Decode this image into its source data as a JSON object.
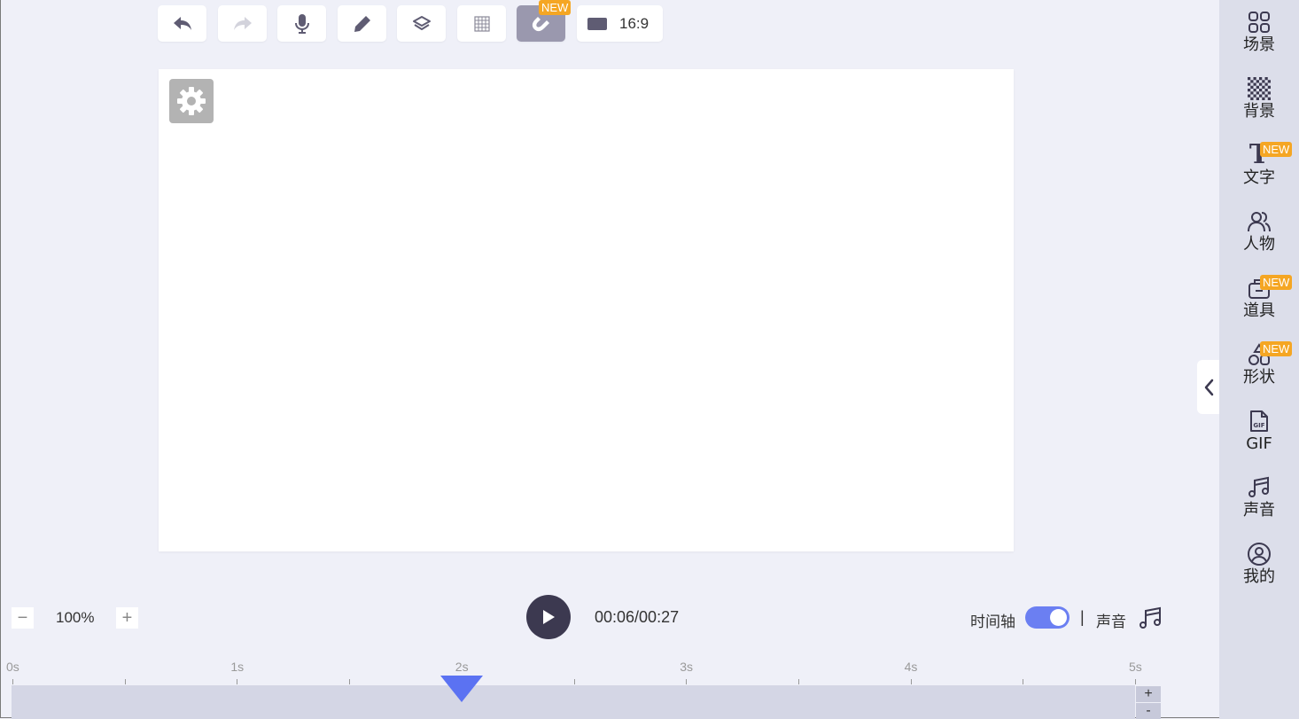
{
  "toolbar": {
    "buttons": [
      {
        "name": "undo-button",
        "icon": "undo-icon"
      },
      {
        "name": "redo-button",
        "icon": "redo-icon"
      },
      {
        "name": "microphone-button",
        "icon": "microphone-icon"
      },
      {
        "name": "pen-button",
        "icon": "pen-icon"
      },
      {
        "name": "layers-button",
        "icon": "layers-icon"
      },
      {
        "name": "grid-button",
        "icon": "grid-icon"
      },
      {
        "name": "magnet-button",
        "icon": "magnet-icon",
        "badge": "NEW",
        "active": true
      }
    ],
    "aspect_ratio": "16:9"
  },
  "canvas": {
    "settings_icon": "gear-icon"
  },
  "sidebar": {
    "items": [
      {
        "label": "场景",
        "icon": "scenes-icon"
      },
      {
        "label": "背景",
        "icon": "background-checker-icon"
      },
      {
        "label": "文字",
        "icon": "text-icon",
        "badge": "NEW"
      },
      {
        "label": "人物",
        "icon": "people-icon"
      },
      {
        "label": "道具",
        "icon": "props-icon",
        "badge": "NEW"
      },
      {
        "label": "形状",
        "icon": "shapes-icon",
        "badge": "NEW"
      },
      {
        "label": "GIF",
        "icon": "gif-icon"
      },
      {
        "label": "声音",
        "icon": "music-note-icon"
      },
      {
        "label": "我的",
        "icon": "user-icon"
      }
    ]
  },
  "controls": {
    "zoom_value": "100%",
    "zoom_minus": "−",
    "zoom_plus": "+",
    "time": "00:06/00:27",
    "timeline_label": "时间轴",
    "timeline_enabled": true,
    "separator": "|",
    "sound_label": "声音"
  },
  "ruler": {
    "labels": [
      "0s",
      "1s",
      "2s",
      "3s",
      "4s",
      "5s"
    ],
    "playhead_seconds": 2.0
  },
  "track_controls": {
    "plus": "+",
    "minus": "-"
  },
  "colors": {
    "accent": "#5b72f2",
    "badge": "#f5a623",
    "play_button": "#3c3950",
    "sidebar_bg": "#dcdeea",
    "page_bg": "#eff0f8"
  }
}
